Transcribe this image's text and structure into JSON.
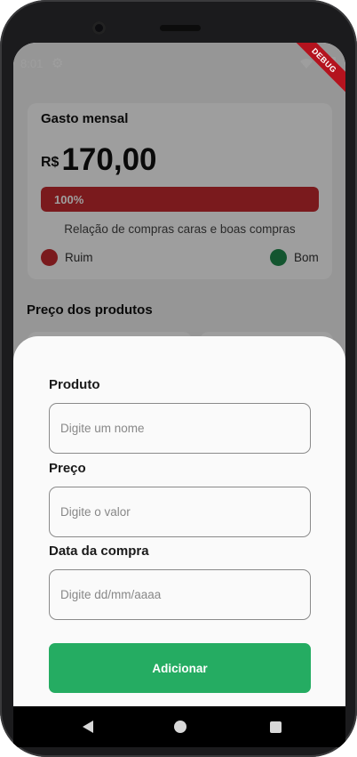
{
  "status_bar": {
    "time": "8:01",
    "settings_icon": "gear-icon",
    "wifi_icon": "wifi-icon",
    "battery_icon": "battery-icon",
    "debug_label": "DEBUG"
  },
  "summary": {
    "title": "Gasto mensal",
    "currency": "R$",
    "amount": "170,00",
    "progress_label": "100%",
    "progress_fraction": 1.0,
    "relation_text": "Relação de compras caras e boas compras",
    "legend": [
      {
        "label": "Ruim",
        "color": "#c62b2f"
      },
      {
        "label": "Bom",
        "color": "#1f8a4c"
      }
    ]
  },
  "products_section": {
    "title": "Preço dos produtos"
  },
  "sheet": {
    "fields": [
      {
        "label": "Produto",
        "placeholder": "Digite um nome",
        "value": ""
      },
      {
        "label": "Preço",
        "placeholder": "Digite o valor",
        "value": ""
      },
      {
        "label": "Data da compra",
        "placeholder": "Digite dd/mm/aaaa",
        "value": ""
      }
    ],
    "submit_label": "Adicionar"
  },
  "colors": {
    "accent_green": "#25ac62",
    "alert_red": "#c62b2f"
  },
  "nav": {
    "back_icon": "back-triangle-icon",
    "home_icon": "home-circle-icon",
    "recent_icon": "recent-apps-square-icon"
  }
}
